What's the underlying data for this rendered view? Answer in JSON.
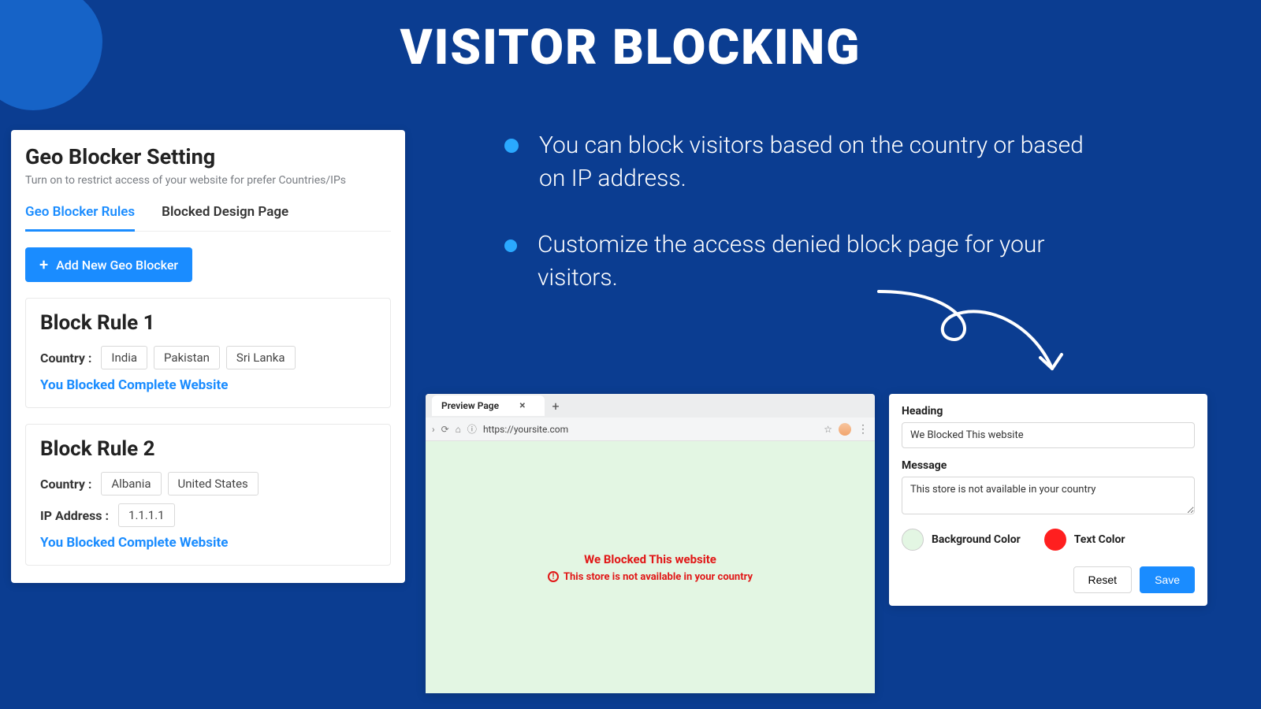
{
  "banner": {
    "title": "VISITOR BLOCKING"
  },
  "bullets": [
    "You can block visitors based on the country or based on IP address.",
    "Customize the access denied block page for your visitors."
  ],
  "panel": {
    "title": "Geo Blocker Setting",
    "subtitle": "Turn on to restrict access of your website for prefer Countries/IPs",
    "tabs": {
      "rules": "Geo Blocker Rules",
      "design": "Blocked Design Page"
    },
    "addButton": "Add New Geo Blocker",
    "countryLabel": "Country :",
    "ipLabel": "IP Address :",
    "blockedMsg": "You Blocked Complete Website",
    "rules": [
      {
        "title": "Block Rule 1",
        "countries": [
          "India",
          "Pakistan",
          "Sri Lanka"
        ],
        "ips": []
      },
      {
        "title": "Block Rule 2",
        "countries": [
          "Albania",
          "United States"
        ],
        "ips": [
          "1.1.1.1"
        ]
      }
    ]
  },
  "browser": {
    "tabTitle": "Preview Page",
    "url": "https://yoursite.com",
    "preview": {
      "heading": "We Blocked This website",
      "message": "This store is not available in your country"
    }
  },
  "editor": {
    "headingLabel": "Heading",
    "headingValue": "We Blocked This website",
    "messageLabel": "Message",
    "messageValue": "This store is not available in your country",
    "bgLabel": "Background Color",
    "textLabel": "Text Color",
    "colors": {
      "bg": "#e3f6e3",
      "text": "#ff1f1f"
    },
    "reset": "Reset",
    "save": "Save"
  }
}
